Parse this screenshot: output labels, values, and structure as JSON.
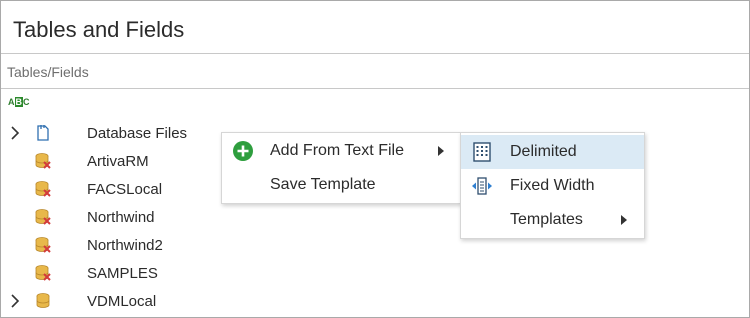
{
  "panel": {
    "title": "Tables and Fields",
    "subheader": "Tables/Fields"
  },
  "toolbar": {
    "abc_icon": "abc-sort-icon",
    "abc_a": "A",
    "abc_b": "B",
    "abc_c": "C"
  },
  "tree": {
    "items": [
      {
        "label": "Database Files",
        "icon": "folder-file-icon",
        "expandable": true
      },
      {
        "label": "ArtivaRM",
        "icon": "database-error-icon",
        "expandable": false
      },
      {
        "label": "FACSLocal",
        "icon": "database-error-icon",
        "expandable": false
      },
      {
        "label": "Northwind",
        "icon": "database-error-icon",
        "expandable": false
      },
      {
        "label": "Northwind2",
        "icon": "database-error-icon",
        "expandable": false
      },
      {
        "label": "SAMPLES",
        "icon": "database-error-icon",
        "expandable": false
      },
      {
        "label": "VDMLocal",
        "icon": "database-icon",
        "expandable": true
      }
    ]
  },
  "context_menu": {
    "items": [
      {
        "label": "Add From Text File",
        "icon": "add-circle-icon",
        "has_submenu": true
      },
      {
        "label": "Save Template",
        "icon": "",
        "has_submenu": false
      }
    ]
  },
  "submenu": {
    "items": [
      {
        "label": "Delimited",
        "icon": "delimited-grid-icon",
        "highlighted": true
      },
      {
        "label": "Fixed Width",
        "icon": "fixed-width-icon",
        "highlighted": false
      },
      {
        "label": "Templates",
        "icon": "",
        "has_submenu": true
      }
    ]
  },
  "colors": {
    "accent_green": "#2e9e3e",
    "highlight": "#dbeaf5",
    "db_gold": "#e8b84a",
    "error_red": "#d23b3b"
  }
}
